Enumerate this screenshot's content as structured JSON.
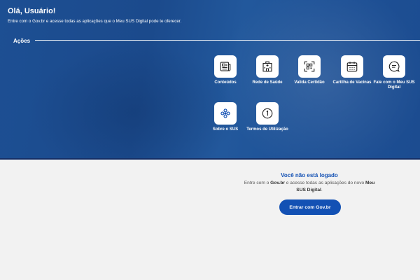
{
  "header": {
    "greeting": "Olá, Usuário!",
    "subtitle": "Entre com o Gov.br e acesse todas as aplicações que o Meu SUS Digital pode te oferecer."
  },
  "actions": {
    "title": "Ações",
    "items": [
      {
        "label": "Conteúdos",
        "icon": "news-icon"
      },
      {
        "label": "Rede de Saúde",
        "icon": "hospital-icon"
      },
      {
        "label": "Valida Certidão",
        "icon": "qr-scan-icon"
      },
      {
        "label": "Cartilha de Vacinas",
        "icon": "calendar-icon"
      },
      {
        "label": "Fale com o Meu SUS Digital",
        "icon": "chat-icon"
      },
      {
        "label": "Sobre o SUS",
        "icon": "sus-cross-icon"
      },
      {
        "label": "Termos de Utilização",
        "icon": "info-circle-icon"
      }
    ]
  },
  "login": {
    "title": "Você não está logado",
    "text_1": "Entre com o ",
    "text_govbr": "Gov.br",
    "text_2": " e acesse todas as aplicações do novo ",
    "text_app": "Meu SUS Digital",
    "text_3": ".",
    "button_label": "Entrar com Gov.br"
  },
  "colors": {
    "hero_blue": "#1d4f93",
    "accent_blue": "#1351b4",
    "background": "#f2f2f2"
  }
}
